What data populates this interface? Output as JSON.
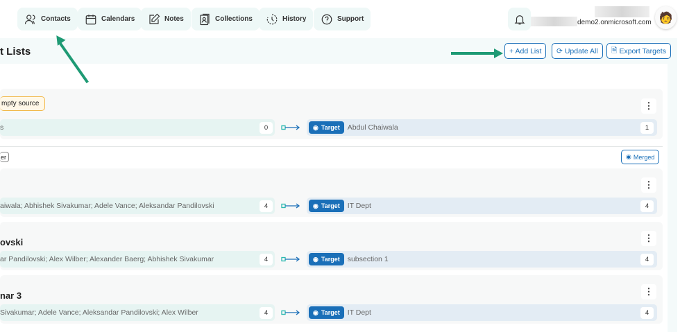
{
  "nav": [
    {
      "label": "Contacts",
      "icon": "users-icon"
    },
    {
      "label": "Calendars",
      "icon": "calendar-icon"
    },
    {
      "label": "Notes",
      "icon": "edit-icon"
    },
    {
      "label": "Collections",
      "icon": "collection-icon"
    },
    {
      "label": "History",
      "icon": "history-icon"
    },
    {
      "label": "Support",
      "icon": "help-icon"
    }
  ],
  "user": {
    "email": "demo2.onmicrosoft.com"
  },
  "page": {
    "title": "t Lists",
    "add_list": "+ Add List",
    "update_all": "Update All",
    "export_targets": "Export Targets"
  },
  "groups": [
    {
      "badge": "mpty source",
      "source": "s",
      "source_count": "0",
      "target_label": "Target",
      "target": "Abdul Chaiwala",
      "target_count": "1"
    }
  ],
  "merged_section": {
    "badge": "er",
    "merged_label": "Merged"
  },
  "lists": [
    {
      "title": "",
      "source": "aiwala; Abhishek Sivakumar; Adele Vance; Aleksandar Pandilovski",
      "source_count": "4",
      "target_label": "Target",
      "target": "IT Dept",
      "target_count": "4"
    },
    {
      "title": "ovski",
      "source": "ar Pandilovski; Alex Wilber; Alexander Baerg; Abhishek Sivakumar",
      "source_count": "4",
      "target_label": "Target",
      "target": "subsection 1",
      "target_count": "4"
    },
    {
      "title": "nar 3",
      "source": " Sivakumar; Adele Vance; Aleksandar Pandilovski; Alex Wilber",
      "source_count": "4",
      "target_label": "Target",
      "target": "IT Dept",
      "target_count": "4"
    }
  ],
  "colors": {
    "accent": "#1a6fb8",
    "annotation_arrow": "#1e9a74"
  }
}
